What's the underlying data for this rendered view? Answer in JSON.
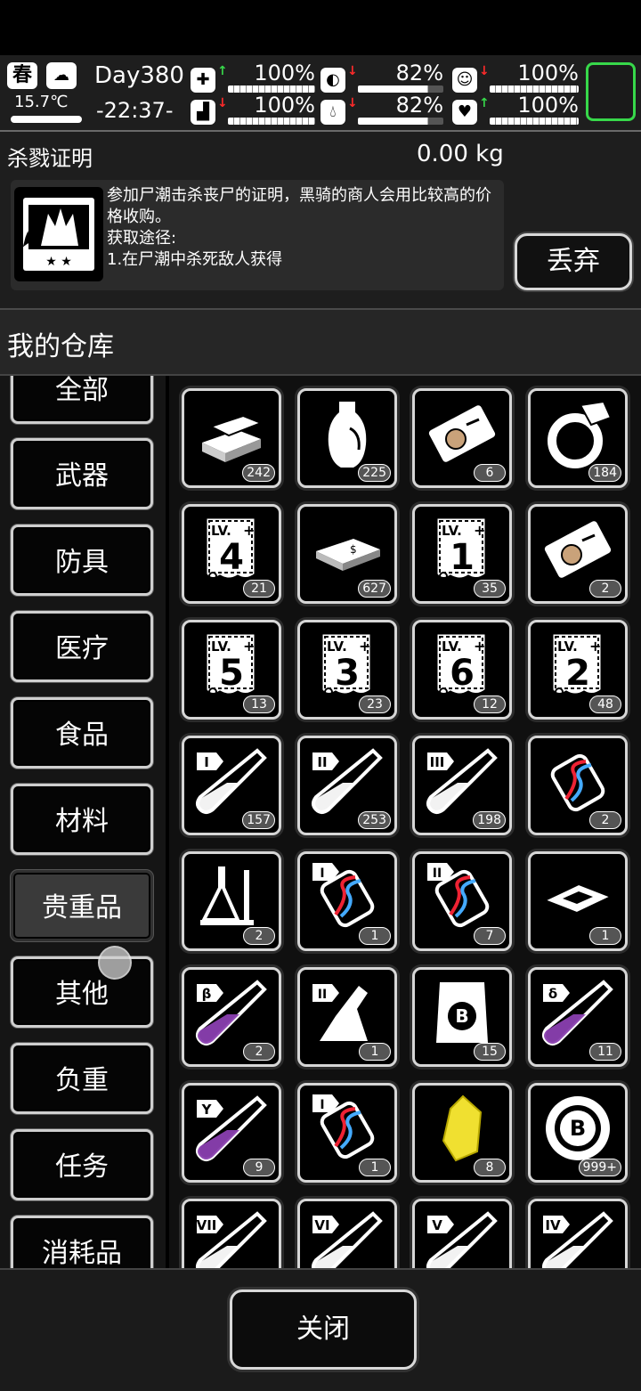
{
  "status": {
    "season": "春",
    "weather_icon": "cloudy-night-icon",
    "temperature": "15.7℃",
    "day": "Day380",
    "time": "-22:37-",
    "stats": [
      {
        "name": "health",
        "icon": "medkit-icon",
        "trend": "up",
        "value": "100%"
      },
      {
        "name": "hunger",
        "icon": "stomach-icon",
        "trend": "down",
        "value": "82%"
      },
      {
        "name": "mood",
        "icon": "face-icon",
        "trend": "down",
        "value": "100%"
      },
      {
        "name": "stamina",
        "icon": "boot-icon",
        "trend": "down",
        "value": "100%"
      },
      {
        "name": "thirst",
        "icon": "water-drop-icon",
        "trend": "down",
        "value": "82%"
      },
      {
        "name": "spirit",
        "icon": "heart-icon",
        "trend": "up",
        "value": "100%"
      }
    ],
    "accent_green": "#37d84a"
  },
  "detail": {
    "name": "杀戮证明",
    "weight": "0.00  kg",
    "description": "参加尸潮击杀丧尸的证明，黑骑的商人会用比较高的价格收购。\n获取途径:\n1.在尸潮中杀死敌人获得",
    "discard_label": "丢弃"
  },
  "warehouse": {
    "title": "我的仓库",
    "categories": [
      "全部",
      "武器",
      "防具",
      "医疗",
      "食品",
      "材料",
      "贵重品",
      "其他",
      "负重",
      "任务",
      "消耗品"
    ],
    "selected_category": "贵重品"
  },
  "items": [
    {
      "icon": "gold-bars-icon",
      "count": "242"
    },
    {
      "icon": "vase-icon",
      "count": "225"
    },
    {
      "icon": "ticket-icon",
      "count": "6"
    },
    {
      "icon": "ring-icon",
      "count": "184"
    },
    {
      "icon": "skill-book-lv4-icon",
      "label": "4",
      "count": "21"
    },
    {
      "icon": "cash-stack-icon",
      "count": "627"
    },
    {
      "icon": "skill-book-lv1-icon",
      "label": "1",
      "count": "35"
    },
    {
      "icon": "ticket-icon",
      "count": "2"
    },
    {
      "icon": "skill-book-lv5-icon",
      "label": "5",
      "count": "13"
    },
    {
      "icon": "skill-book-lv3-icon",
      "label": "3",
      "count": "23"
    },
    {
      "icon": "skill-book-lv6-icon",
      "label": "6",
      "count": "12"
    },
    {
      "icon": "skill-book-lv2-icon",
      "label": "2",
      "count": "48"
    },
    {
      "icon": "test-tube-i-icon",
      "label": "I",
      "count": "157"
    },
    {
      "icon": "test-tube-ii-icon",
      "label": "II",
      "count": "253"
    },
    {
      "icon": "test-tube-iii-icon",
      "label": "III",
      "count": "198"
    },
    {
      "icon": "dna-capsule-broken-icon",
      "count": "2"
    },
    {
      "icon": "lab-equipment-icon",
      "count": "2"
    },
    {
      "icon": "dna-capsule-i-icon",
      "label": "I",
      "count": "1"
    },
    {
      "icon": "dna-capsule-ii-icon",
      "label": "II",
      "count": "7"
    },
    {
      "icon": "cpu-chip-icon",
      "count": "1"
    },
    {
      "icon": "test-tube-beta-icon",
      "label": "β",
      "count": "2"
    },
    {
      "icon": "flask-ii-icon",
      "label": "II",
      "count": "1"
    },
    {
      "icon": "b-coin-note-icon",
      "count": "15"
    },
    {
      "icon": "test-tube-delta-icon",
      "label": "δ",
      "count": "11"
    },
    {
      "icon": "test-tube-gamma-icon",
      "label": "Y",
      "count": "9"
    },
    {
      "icon": "dna-capsule-i-icon",
      "label": "I",
      "count": "1"
    },
    {
      "icon": "yellow-crystal-icon",
      "count": "8"
    },
    {
      "icon": "b-coin-icon",
      "count": "999+"
    },
    {
      "icon": "test-tube-vii-icon",
      "label": "VII",
      "count": ""
    },
    {
      "icon": "test-tube-vi-icon",
      "label": "VI",
      "count": ""
    },
    {
      "icon": "test-tube-v-icon",
      "label": "V",
      "count": ""
    },
    {
      "icon": "test-tube-iv-icon",
      "label": "IV",
      "count": ""
    }
  ],
  "close_label": "关闭"
}
